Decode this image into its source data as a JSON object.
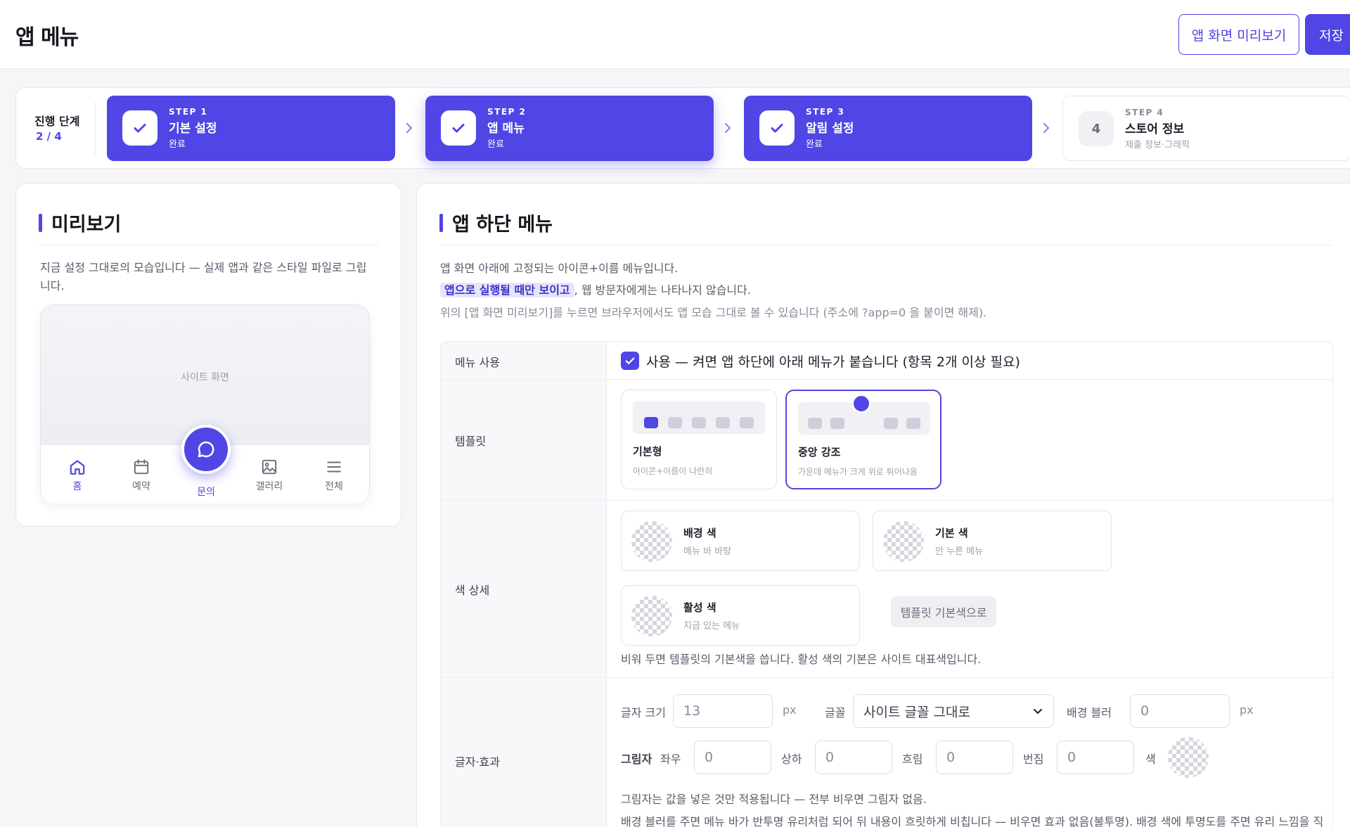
{
  "header": {
    "title": "앱 메뉴",
    "preview_button": "앱 화면 미리보기",
    "save_button": "저장"
  },
  "stepper": {
    "label": "진행 단계",
    "progress": "2 / 4",
    "steps": [
      {
        "kicker": "STEP 1",
        "title": "기본 설정",
        "sub": "완료",
        "state": "done"
      },
      {
        "kicker": "STEP 2",
        "title": "앱 메뉴",
        "sub": "완료",
        "state": "current"
      },
      {
        "kicker": "STEP 3",
        "title": "알림 설정",
        "sub": "완료",
        "state": "done"
      },
      {
        "kicker": "STEP 4",
        "number": "4",
        "title": "스토어 정보",
        "sub": "제출 정보·그래픽",
        "state": "todo"
      }
    ]
  },
  "preview": {
    "title": "미리보기",
    "description": "지금 설정 그대로의 모습입니다 — 실제 앱과 같은 스타일 파일로 그립니다.",
    "site_label": "사이트 화면",
    "nav": [
      {
        "label": "홈",
        "icon": "home-icon"
      },
      {
        "label": "예약",
        "icon": "calendar-icon"
      },
      {
        "label": "문의",
        "icon": "chat-icon"
      },
      {
        "label": "갤러리",
        "icon": "image-icon"
      },
      {
        "label": "전체",
        "icon": "menu-icon"
      }
    ]
  },
  "menu": {
    "title": "앱 하단 메뉴",
    "desc1": "앱 화면 아래에 고정되는 아이콘+이름 메뉴입니다.",
    "desc2_highlight": "앱으로 실행될 때만 보이고",
    "desc2_rest": ", 웹 방문자에게는 나타나지 않습니다.",
    "desc3": "위의 [앱 화면 미리보기]를 누르면 브라우저에서도 앱 모습 그대로 볼 수 있습니다 (주소에 ?app=0 을 붙이면 해제).",
    "rows": {
      "use_label": "메뉴 사용",
      "use_text": "사용 — 켜면 앱 하단에 아래 메뉴가 붙습니다 (항목 2개 이상 필요)",
      "template_label": "템플릿",
      "color_label": "색 상세",
      "font_label": "글자·효과"
    },
    "templates": [
      {
        "name": "기본형",
        "desc": "아이콘+이름이 나란히"
      },
      {
        "name": "중앙 강조",
        "desc": "가운데 메뉴가 크게 위로 튀어나옴"
      }
    ],
    "colors": [
      {
        "name": "배경 색",
        "sub": "메뉴 바 바탕"
      },
      {
        "name": "기본 색",
        "sub": "안 누른 메뉴"
      },
      {
        "name": "활성 색",
        "sub": "지금 있는 메뉴"
      }
    ],
    "reset_button": "템플릿 기본색으로",
    "color_note": "비워 두면 템플릿의 기본색을 씁니다. 활성 색의 기본은 사이트 대표색입니다.",
    "font": {
      "size_label": "글자 크기",
      "size_value": "13",
      "size_unit": "px",
      "family_label": "글꼴",
      "family_value": "사이트 글꼴 그대로",
      "blur_label": "배경 블러",
      "blur_value": "0",
      "blur_unit": "px",
      "shadow_label": "그림자",
      "shadow_x_label": "좌우",
      "shadow_x": "0",
      "shadow_y_label": "상하",
      "shadow_y": "0",
      "shadow_blur_label": "흐림",
      "shadow_blur": "0",
      "shadow_spread_label": "번짐",
      "shadow_spread": "0",
      "shadow_color_label": "색"
    },
    "note1": "그림자는 값을 넣은 것만 적용됩니다 — 전부 비우면 그림자 없음.",
    "note2": "배경 블러를 주면 메뉴 바가 반투명 유리처럼 되어 뒤 내용이 흐릿하게 비칩니다 — 비우면 효과 없음(불투명). 배경 색에 투명도를 주면 유리 느낌을 직접 조절할 수 있습니다."
  },
  "colors": {
    "accent": "#4f46e5"
  }
}
